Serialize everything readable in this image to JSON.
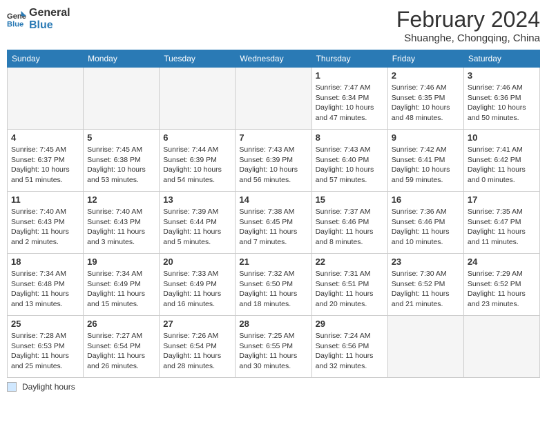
{
  "logo": {
    "line1": "General",
    "line2": "Blue"
  },
  "title": "February 2024",
  "location": "Shuanghe, Chongqing, China",
  "days_header": [
    "Sunday",
    "Monday",
    "Tuesday",
    "Wednesday",
    "Thursday",
    "Friday",
    "Saturday"
  ],
  "footer_label": "Daylight hours",
  "weeks": [
    [
      {
        "day": "",
        "info": ""
      },
      {
        "day": "",
        "info": ""
      },
      {
        "day": "",
        "info": ""
      },
      {
        "day": "",
        "info": ""
      },
      {
        "day": "1",
        "info": "Sunrise: 7:47 AM\nSunset: 6:34 PM\nDaylight: 10 hours\nand 47 minutes."
      },
      {
        "day": "2",
        "info": "Sunrise: 7:46 AM\nSunset: 6:35 PM\nDaylight: 10 hours\nand 48 minutes."
      },
      {
        "day": "3",
        "info": "Sunrise: 7:46 AM\nSunset: 6:36 PM\nDaylight: 10 hours\nand 50 minutes."
      }
    ],
    [
      {
        "day": "4",
        "info": "Sunrise: 7:45 AM\nSunset: 6:37 PM\nDaylight: 10 hours\nand 51 minutes."
      },
      {
        "day": "5",
        "info": "Sunrise: 7:45 AM\nSunset: 6:38 PM\nDaylight: 10 hours\nand 53 minutes."
      },
      {
        "day": "6",
        "info": "Sunrise: 7:44 AM\nSunset: 6:39 PM\nDaylight: 10 hours\nand 54 minutes."
      },
      {
        "day": "7",
        "info": "Sunrise: 7:43 AM\nSunset: 6:39 PM\nDaylight: 10 hours\nand 56 minutes."
      },
      {
        "day": "8",
        "info": "Sunrise: 7:43 AM\nSunset: 6:40 PM\nDaylight: 10 hours\nand 57 minutes."
      },
      {
        "day": "9",
        "info": "Sunrise: 7:42 AM\nSunset: 6:41 PM\nDaylight: 10 hours\nand 59 minutes."
      },
      {
        "day": "10",
        "info": "Sunrise: 7:41 AM\nSunset: 6:42 PM\nDaylight: 11 hours\nand 0 minutes."
      }
    ],
    [
      {
        "day": "11",
        "info": "Sunrise: 7:40 AM\nSunset: 6:43 PM\nDaylight: 11 hours\nand 2 minutes."
      },
      {
        "day": "12",
        "info": "Sunrise: 7:40 AM\nSunset: 6:43 PM\nDaylight: 11 hours\nand 3 minutes."
      },
      {
        "day": "13",
        "info": "Sunrise: 7:39 AM\nSunset: 6:44 PM\nDaylight: 11 hours\nand 5 minutes."
      },
      {
        "day": "14",
        "info": "Sunrise: 7:38 AM\nSunset: 6:45 PM\nDaylight: 11 hours\nand 7 minutes."
      },
      {
        "day": "15",
        "info": "Sunrise: 7:37 AM\nSunset: 6:46 PM\nDaylight: 11 hours\nand 8 minutes."
      },
      {
        "day": "16",
        "info": "Sunrise: 7:36 AM\nSunset: 6:46 PM\nDaylight: 11 hours\nand 10 minutes."
      },
      {
        "day": "17",
        "info": "Sunrise: 7:35 AM\nSunset: 6:47 PM\nDaylight: 11 hours\nand 11 minutes."
      }
    ],
    [
      {
        "day": "18",
        "info": "Sunrise: 7:34 AM\nSunset: 6:48 PM\nDaylight: 11 hours\nand 13 minutes."
      },
      {
        "day": "19",
        "info": "Sunrise: 7:34 AM\nSunset: 6:49 PM\nDaylight: 11 hours\nand 15 minutes."
      },
      {
        "day": "20",
        "info": "Sunrise: 7:33 AM\nSunset: 6:49 PM\nDaylight: 11 hours\nand 16 minutes."
      },
      {
        "day": "21",
        "info": "Sunrise: 7:32 AM\nSunset: 6:50 PM\nDaylight: 11 hours\nand 18 minutes."
      },
      {
        "day": "22",
        "info": "Sunrise: 7:31 AM\nSunset: 6:51 PM\nDaylight: 11 hours\nand 20 minutes."
      },
      {
        "day": "23",
        "info": "Sunrise: 7:30 AM\nSunset: 6:52 PM\nDaylight: 11 hours\nand 21 minutes."
      },
      {
        "day": "24",
        "info": "Sunrise: 7:29 AM\nSunset: 6:52 PM\nDaylight: 11 hours\nand 23 minutes."
      }
    ],
    [
      {
        "day": "25",
        "info": "Sunrise: 7:28 AM\nSunset: 6:53 PM\nDaylight: 11 hours\nand 25 minutes."
      },
      {
        "day": "26",
        "info": "Sunrise: 7:27 AM\nSunset: 6:54 PM\nDaylight: 11 hours\nand 26 minutes."
      },
      {
        "day": "27",
        "info": "Sunrise: 7:26 AM\nSunset: 6:54 PM\nDaylight: 11 hours\nand 28 minutes."
      },
      {
        "day": "28",
        "info": "Sunrise: 7:25 AM\nSunset: 6:55 PM\nDaylight: 11 hours\nand 30 minutes."
      },
      {
        "day": "29",
        "info": "Sunrise: 7:24 AM\nSunset: 6:56 PM\nDaylight: 11 hours\nand 32 minutes."
      },
      {
        "day": "",
        "info": ""
      },
      {
        "day": "",
        "info": ""
      }
    ]
  ]
}
